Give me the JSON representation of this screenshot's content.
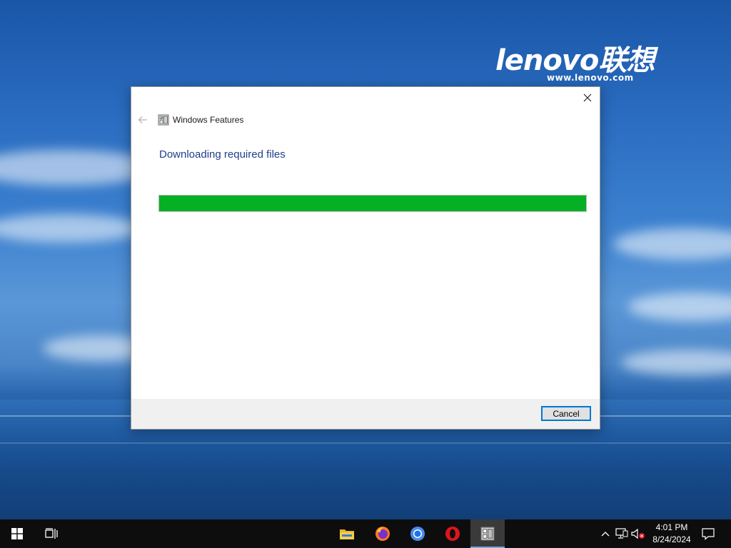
{
  "dialog": {
    "title": "Windows Features",
    "heading": "Downloading required files",
    "progress": 1.0,
    "cancel_label": "Cancel"
  },
  "desktop": {
    "brand_logo": "lenovo联想",
    "brand_url": "www.lenovo.com"
  },
  "taskbar": {
    "pinned": [
      "file-explorer-icon",
      "firefox-icon",
      "chrome-icon",
      "opera-icon",
      "windows-features-icon"
    ],
    "active_app": "windows-features-icon",
    "clock_time": "4:01 PM",
    "clock_date": "8/24/2024"
  },
  "colors": {
    "progress_fill": "#06b025",
    "heading": "#1e3e8a",
    "focus_border": "#0078d7",
    "taskbar": "#0d0d0d"
  }
}
